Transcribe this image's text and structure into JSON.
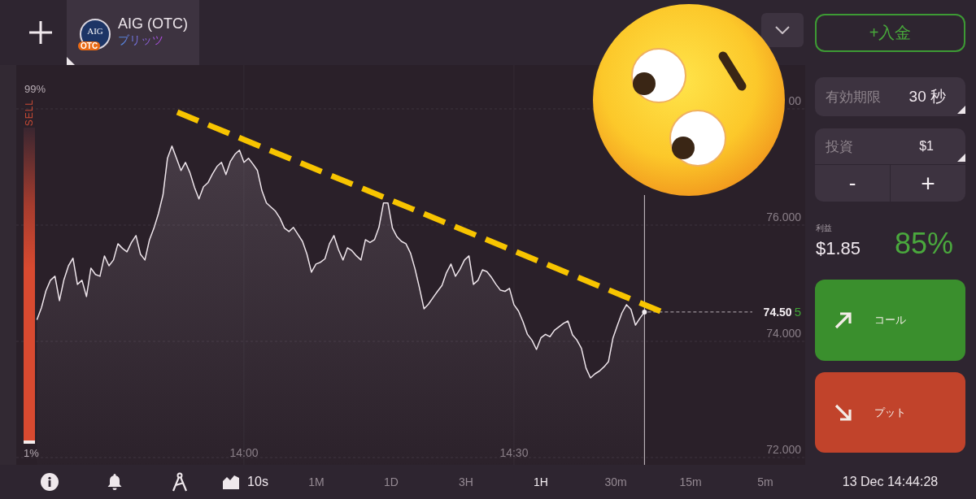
{
  "top_bar": {
    "asset_tab": {
      "name": "AIG (OTC)",
      "mode": "ブリッツ",
      "logo_text": "AIG",
      "logo_badge": "OTC"
    }
  },
  "chart": {
    "sentiment": {
      "top_label": "99%",
      "side_label": "SELL",
      "bottom_label": "1%",
      "level": 0.99
    },
    "current_price": {
      "main": "74.50",
      "last_digit": "5"
    },
    "partly_hidden_y_label": "00",
    "chart_data": {
      "type": "area",
      "grid": true,
      "ylim": [
        71.874,
        78.755
      ],
      "categories": [
        null,
        null,
        null,
        null,
        null,
        null,
        null,
        null,
        null,
        null,
        null,
        null,
        null,
        null,
        null,
        null,
        null,
        null,
        null,
        null,
        null,
        null,
        null,
        null,
        null,
        null,
        null,
        null,
        null,
        null,
        null,
        null,
        null,
        null,
        null,
        null,
        null,
        null,
        null,
        null,
        null,
        null,
        null,
        null,
        null,
        null,
        null,
        null,
        null,
        null,
        "14:00",
        null,
        null,
        null,
        null,
        null,
        null,
        null,
        null,
        null,
        null,
        null,
        null,
        null,
        null,
        null,
        null,
        null,
        null,
        null,
        null,
        null,
        null,
        null,
        null,
        null,
        null,
        null,
        null,
        null,
        null,
        null,
        null,
        null,
        null,
        null,
        null,
        null,
        null,
        null,
        null,
        null,
        null,
        null,
        null,
        null,
        null,
        null,
        null,
        null,
        null,
        null,
        null,
        null,
        null,
        null,
        null,
        null,
        null,
        null,
        "14:30",
        null,
        null,
        null,
        null,
        null,
        null,
        null,
        null,
        null,
        null,
        null,
        null,
        null,
        null,
        null,
        null,
        null,
        null,
        null,
        null,
        null,
        null,
        null,
        null,
        null,
        null,
        null,
        null,
        null
      ],
      "values": [
        null,
        null,
        null,
        null,
        74.37,
        74.58,
        74.87,
        75.05,
        75.12,
        74.7,
        75.06,
        75.3,
        75.43,
        74.98,
        75.05,
        74.77,
        75.26,
        75.15,
        75.12,
        75.47,
        75.3,
        75.4,
        75.68,
        75.6,
        75.54,
        75.7,
        75.82,
        75.5,
        75.4,
        75.75,
        75.95,
        76.2,
        76.52,
        77.15,
        77.36,
        77.15,
        76.94,
        77.08,
        76.9,
        76.65,
        76.45,
        76.66,
        76.73,
        76.88,
        77.01,
        77.08,
        76.87,
        77.1,
        77.22,
        77.29,
        77.08,
        77.15,
        77.05,
        76.94,
        76.59,
        76.38,
        76.31,
        76.24,
        76.12,
        75.95,
        75.89,
        75.96,
        75.84,
        75.72,
        75.5,
        75.19,
        75.33,
        75.36,
        75.42,
        75.68,
        75.82,
        75.58,
        75.4,
        75.61,
        75.56,
        75.47,
        75.4,
        75.75,
        75.7,
        75.75,
        75.96,
        76.38,
        76.38,
        75.95,
        75.8,
        75.72,
        75.68,
        75.52,
        75.25,
        74.92,
        74.56,
        74.64,
        74.75,
        74.86,
        74.96,
        75.18,
        75.33,
        75.12,
        75.24,
        75.4,
        75.47,
        74.98,
        75.05,
        75.23,
        75.2,
        75.1,
        74.98,
        74.88,
        74.86,
        74.91,
        74.63,
        74.52,
        74.34,
        74.12,
        74.02,
        73.86,
        74.06,
        74.12,
        74.08,
        74.19,
        74.25,
        74.31,
        74.35,
        74.11,
        74.02,
        73.88,
        73.54,
        73.37,
        73.44,
        73.49,
        73.56,
        73.65,
        74.06,
        74.28,
        74.49,
        74.63,
        74.55,
        74.28,
        74.4,
        74.505
      ],
      "yticks": [
        {
          "value": 76,
          "label": "76.000"
        },
        {
          "value": 74,
          "label": "74.000"
        },
        {
          "value": 72,
          "label": "72.000"
        }
      ]
    }
  },
  "toolbar": {
    "candle_size": "10s",
    "periods": [
      {
        "label": "1M",
        "selected": false
      },
      {
        "label": "1D",
        "selected": false
      },
      {
        "label": "3H",
        "selected": false
      },
      {
        "label": "1H",
        "selected": true
      },
      {
        "label": "30m",
        "selected": false
      },
      {
        "label": "15m",
        "selected": false
      },
      {
        "label": "5m",
        "selected": false
      }
    ]
  },
  "sidebar": {
    "deposit_button": "+入金",
    "expiry": {
      "label": "有効期限",
      "value": "30 秒"
    },
    "investment": {
      "label": "投資",
      "value": "$1",
      "decrease": "-",
      "increase": "+"
    },
    "profit": {
      "label": "利益",
      "amount": "$1.85",
      "percent": "85%"
    },
    "call_button": "コール",
    "put_button": "プット",
    "clock": "13 Dec 14:44:28"
  }
}
